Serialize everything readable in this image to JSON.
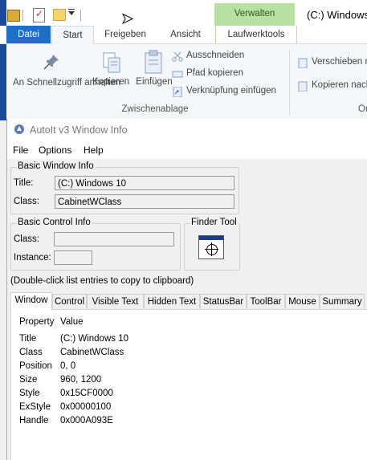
{
  "explorer": {
    "context_group": "Verwalten",
    "window_title": "(C:) Windows",
    "tabs": {
      "datei": "Datei",
      "start": "Start",
      "freigeben": "Freigeben",
      "ansicht": "Ansicht",
      "laufwerktools": "Laufwerktools"
    },
    "clipboard": {
      "pin_label": "An Schnellzugriff anheften",
      "copy_label": "Kopieren",
      "paste_label": "Einfügen",
      "cut_label": "Ausschneiden",
      "copy_path_label": "Pfad kopieren",
      "paste_shortcut_label": "Verknüpfung einfügen",
      "group_label": "Zwischenablage"
    },
    "organize": {
      "move_to_label": "Verschieben n",
      "copy_to_label": "Kopieren nach",
      "group_label": "Or"
    }
  },
  "autoit": {
    "title": "AutoIt v3 Window Info",
    "menu": {
      "file": "File",
      "options": "Options",
      "help": "Help"
    },
    "basic_window": {
      "label": "Basic Window Info",
      "title_label": "Title:",
      "title_value": "(C:) Windows 10",
      "class_label": "Class:",
      "class_value": "CabinetWClass"
    },
    "basic_control": {
      "label": "Basic Control Info",
      "class_label": "Class:",
      "class_value": "",
      "instance_label": "Instance:",
      "instance_value": ""
    },
    "finder": {
      "label": "Finder Tool"
    },
    "hint": "(Double-click list entries to copy to clipboard)",
    "tabs": [
      "Window",
      "Control",
      "Visible Text",
      "Hidden Text",
      "StatusBar",
      "ToolBar",
      "Mouse",
      "Summary"
    ],
    "active_tab": "Window",
    "list": {
      "headers": {
        "property": "Property",
        "value": "Value"
      },
      "rows": [
        {
          "property": "Title",
          "value": "(C:) Windows 10"
        },
        {
          "property": "Class",
          "value": "CabinetWClass"
        },
        {
          "property": "Position",
          "value": "0, 0"
        },
        {
          "property": "Size",
          "value": "960, 1200"
        },
        {
          "property": "Style",
          "value": "0x15CF0000"
        },
        {
          "property": "ExStyle",
          "value": "0x00000100"
        },
        {
          "property": "Handle",
          "value": "0x000A093E"
        }
      ]
    }
  }
}
